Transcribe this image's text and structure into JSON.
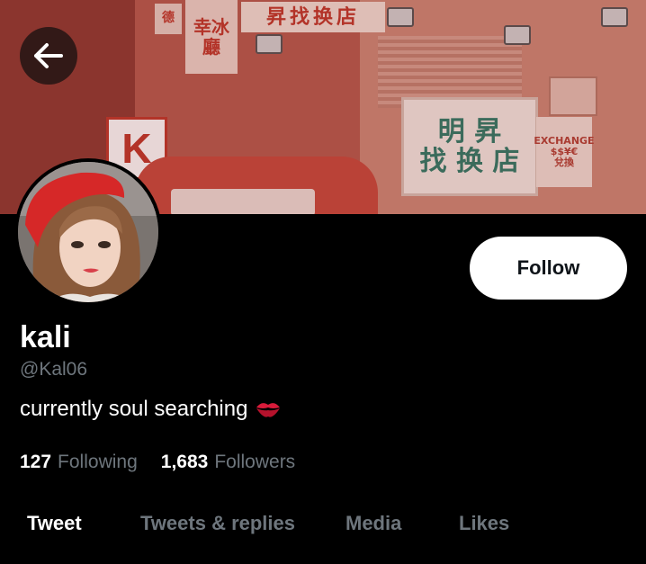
{
  "header": {
    "back_icon": "arrow-left-icon"
  },
  "banner": {
    "sign_top": "昇找换店",
    "sign_vertical": "幸冰廳",
    "sign_small": "德",
    "sign_big_line1": "明 昇",
    "sign_big_line2": "找 换 店",
    "sign_exchange_line1": "EXCHANGE",
    "sign_exchange_line2": "$$¥€",
    "sign_exchange_line3": "兌換",
    "k_sign": "K"
  },
  "profile": {
    "name": "kali",
    "handle": "@Kal06",
    "bio": "currently soul searching",
    "bio_emoji": "kiss-mark-icon",
    "follow_label": "Follow",
    "following_count": "127",
    "following_label": "Following",
    "followers_count": "1,683",
    "followers_label": "Followers"
  },
  "tabs": [
    {
      "label": "Tweet",
      "active": true
    },
    {
      "label": "Tweets & replies",
      "active": false
    },
    {
      "label": "Media",
      "active": false
    },
    {
      "label": "Likes",
      "active": false
    }
  ],
  "colors": {
    "background": "#000000",
    "text_primary": "#ffffff",
    "text_secondary": "#6e767d",
    "follow_bg": "#ffffff"
  }
}
